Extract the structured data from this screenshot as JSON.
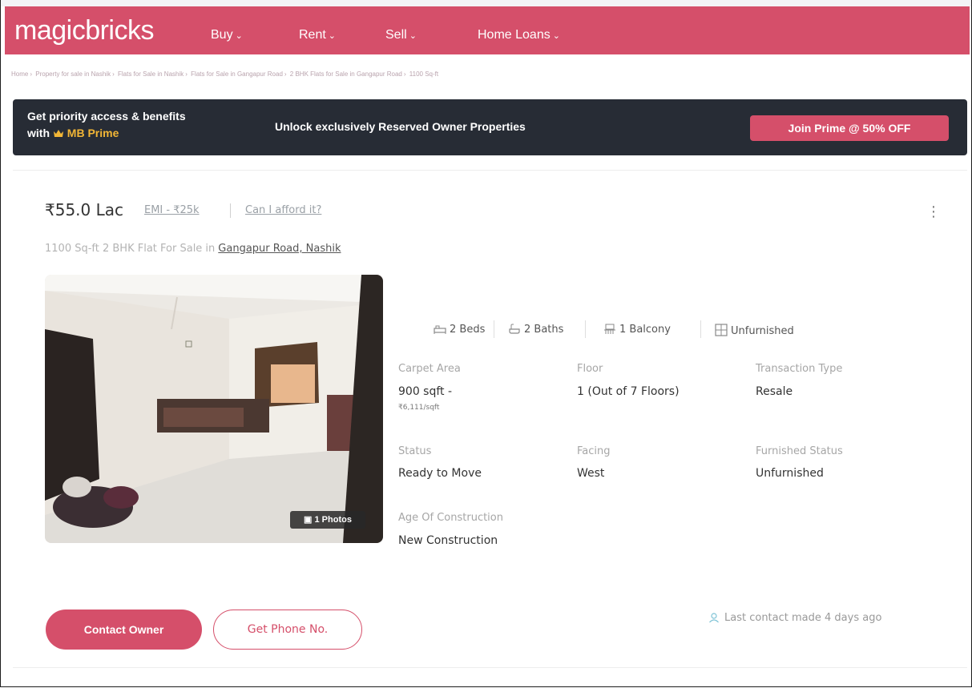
{
  "colors": {
    "brand": "#d54f6a",
    "banner_bg": "#272c35",
    "prime_gold": "#f2b636"
  },
  "header": {
    "logo": "magicbricks",
    "nav": [
      {
        "label": "Buy",
        "icon": "chevron-down-icon"
      },
      {
        "label": "Rent",
        "icon": "chevron-down-icon"
      },
      {
        "label": "Sell",
        "icon": "chevron-down-icon"
      },
      {
        "label": "Home Loans",
        "icon": "chevron-down-icon"
      }
    ]
  },
  "breadcrumb": [
    "Home",
    "Property for sale in Nashik",
    "Flats for Sale in Nashik",
    "Flats for Sale in Gangapur Road",
    "2 BHK Flats for Sale in Gangapur Road",
    "1100 Sq-ft"
  ],
  "prime_banner": {
    "line1": "Get priority access & benefits",
    "line2_prefix": "with",
    "crown_icon": "crown-icon",
    "brand": "MB Prime",
    "message": "Unlock exclusively Reserved Owner Properties",
    "button": "Join Prime @ 50% OFF"
  },
  "listing": {
    "price": "₹55.0 Lac",
    "emi": "EMI - ₹25k",
    "afford": "Can I afford it?",
    "subtitle": "1100 Sq-ft 2 BHK Flat For Sale in",
    "location": "Gangapur Road, Nashik",
    "photos_badge": "1 Photos",
    "amenities": [
      {
        "icon": "bed-icon",
        "label": "2 Beds"
      },
      {
        "icon": "bath-icon",
        "label": "2 Baths"
      },
      {
        "icon": "balcony-icon",
        "label": "1 Balcony"
      },
      {
        "icon": "furniture-icon",
        "label": "Unfurnished"
      }
    ],
    "details": {
      "carpet_area": {
        "label": "Carpet Area",
        "value": "900 sqft -",
        "sub": "₹6,111/sqft"
      },
      "floor": {
        "label": "Floor",
        "value": "1 (Out of 7 Floors)"
      },
      "transaction_type": {
        "label": "Transaction Type",
        "value": "Resale"
      },
      "status": {
        "label": "Status",
        "value": "Ready to Move"
      },
      "facing": {
        "label": "Facing",
        "value": "West"
      },
      "furnished_status": {
        "label": "Furnished Status",
        "value": "Unfurnished"
      },
      "age": {
        "label": "Age Of Construction",
        "value": "New Construction"
      }
    },
    "contact_button": "Contact Owner",
    "phone_button": "Get Phone No.",
    "last_contact": "Last contact made 4 days ago"
  }
}
